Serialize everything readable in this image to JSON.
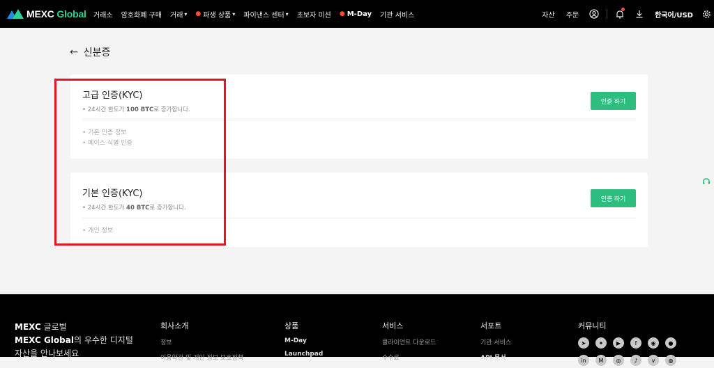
{
  "nav": {
    "brand_main": "MEXC",
    "brand_accent": "Global",
    "items": [
      {
        "label": "거래소"
      },
      {
        "label": "암호화폐 구매"
      },
      {
        "label": "거래"
      },
      {
        "label": "파생 상품"
      },
      {
        "label": "파이낸스 센터"
      },
      {
        "label": "초보자 미션"
      },
      {
        "label": "M-Day"
      },
      {
        "label": "기관 서비스"
      }
    ],
    "right": {
      "assets": "자산",
      "orders": "주문",
      "language": "한국어/USD"
    },
    "icons": [
      "user-icon",
      "bell-icon",
      "download-icon",
      "gear-icon"
    ]
  },
  "page": {
    "title": "신분증",
    "back_icon": "arrow-left-icon"
  },
  "cards": [
    {
      "title": "고급 인증(KYC)",
      "sub_prefix": "24시간 한도가",
      "sub_value": "100 BTC",
      "sub_suffix": "로 증가합니다.",
      "bullets": [
        "기본 인증 정보",
        "페이스 식별 인증"
      ],
      "button": "인증 하기"
    },
    {
      "title": "기본 인증(KYC)",
      "sub_prefix": "24시간 한도가",
      "sub_value": "40 BTC",
      "sub_suffix": "로 증가합니다.",
      "bullets": [
        "개인 정보"
      ],
      "button": "인증 하기"
    }
  ],
  "footer": {
    "brand_line1_a": "MEXC",
    "brand_line1_b": " 글로벌",
    "brand_line2_a": "MEXC Global",
    "brand_line2_b": "의 우수한 디지털",
    "brand_line3": "자산을 안나보세요",
    "columns": [
      {
        "head": "회사소개",
        "links": [
          "정보",
          "이용약관 및 개인 정보 보호정책"
        ]
      },
      {
        "head": "상품",
        "links": [
          "M-Day",
          "Launchpad"
        ]
      },
      {
        "head": "서비스",
        "links": [
          "클라이언트 다운로드",
          "수수료"
        ]
      },
      {
        "head": "서포트",
        "links": [
          "기관 서비스",
          "API 문서"
        ]
      },
      {
        "head": "커뮤니티",
        "links": []
      }
    ]
  },
  "colors": {
    "accent": "#2dbd7f",
    "highlight": "#e5141f"
  }
}
